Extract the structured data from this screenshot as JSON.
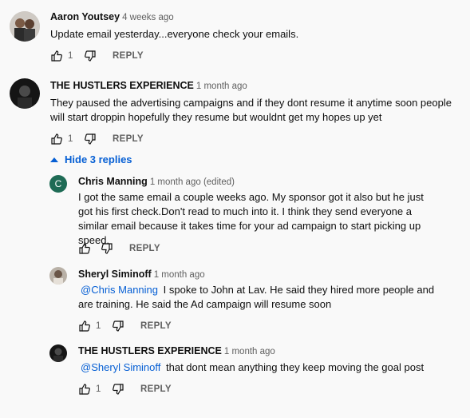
{
  "comments": [
    {
      "author": "Aaron Youtsey",
      "time": "4 weeks ago",
      "text": "Update email yesterday...everyone check your emails.",
      "likes": "1",
      "reply_label": "REPLY",
      "avatar_icon": "two-people-photo"
    },
    {
      "author": "THE HUSTLERS EXPERIENCE",
      "time": "1 month ago",
      "text": "They paused the advertising campaigns and if they dont resume it anytime soon people will start droppin hopefully they resume but wouldnt get my hopes up yet",
      "likes": "1",
      "reply_label": "REPLY",
      "avatar_icon": "dark-person-photo"
    }
  ],
  "hide_replies_label": "Hide 3 replies",
  "replies": [
    {
      "author": "Chris Manning",
      "time": "1 month ago (edited)",
      "text": "I got the same email a couple weeks ago. My sponsor got it also but he just got his first check.Don't read to much into it. I think they send everyone a similar email because it takes time for your ad campaign to start picking up speed.",
      "likes": "",
      "reply_label": "REPLY",
      "avatar_letter": "C",
      "avatar_color": "#1e6b55"
    },
    {
      "author": "Sheryl Siminoff",
      "time": "1 month ago",
      "mention": "@Chris Manning",
      "text": "I spoke to John at Lav. He said they hired more people and are training.  He said the Ad campaign will resume soon",
      "likes": "1",
      "reply_label": "REPLY",
      "avatar_icon": "person-photo"
    },
    {
      "author": "THE HUSTLERS EXPERIENCE",
      "time": "1 month ago",
      "mention": "@Sheryl Siminoff",
      "text": "that dont mean anything they keep moving the goal post",
      "likes": "1",
      "reply_label": "REPLY",
      "avatar_icon": "dark-person-photo"
    }
  ],
  "colors": {
    "background": "#f9f9f9",
    "link": "#065fd4",
    "secondary_text": "#606060"
  }
}
